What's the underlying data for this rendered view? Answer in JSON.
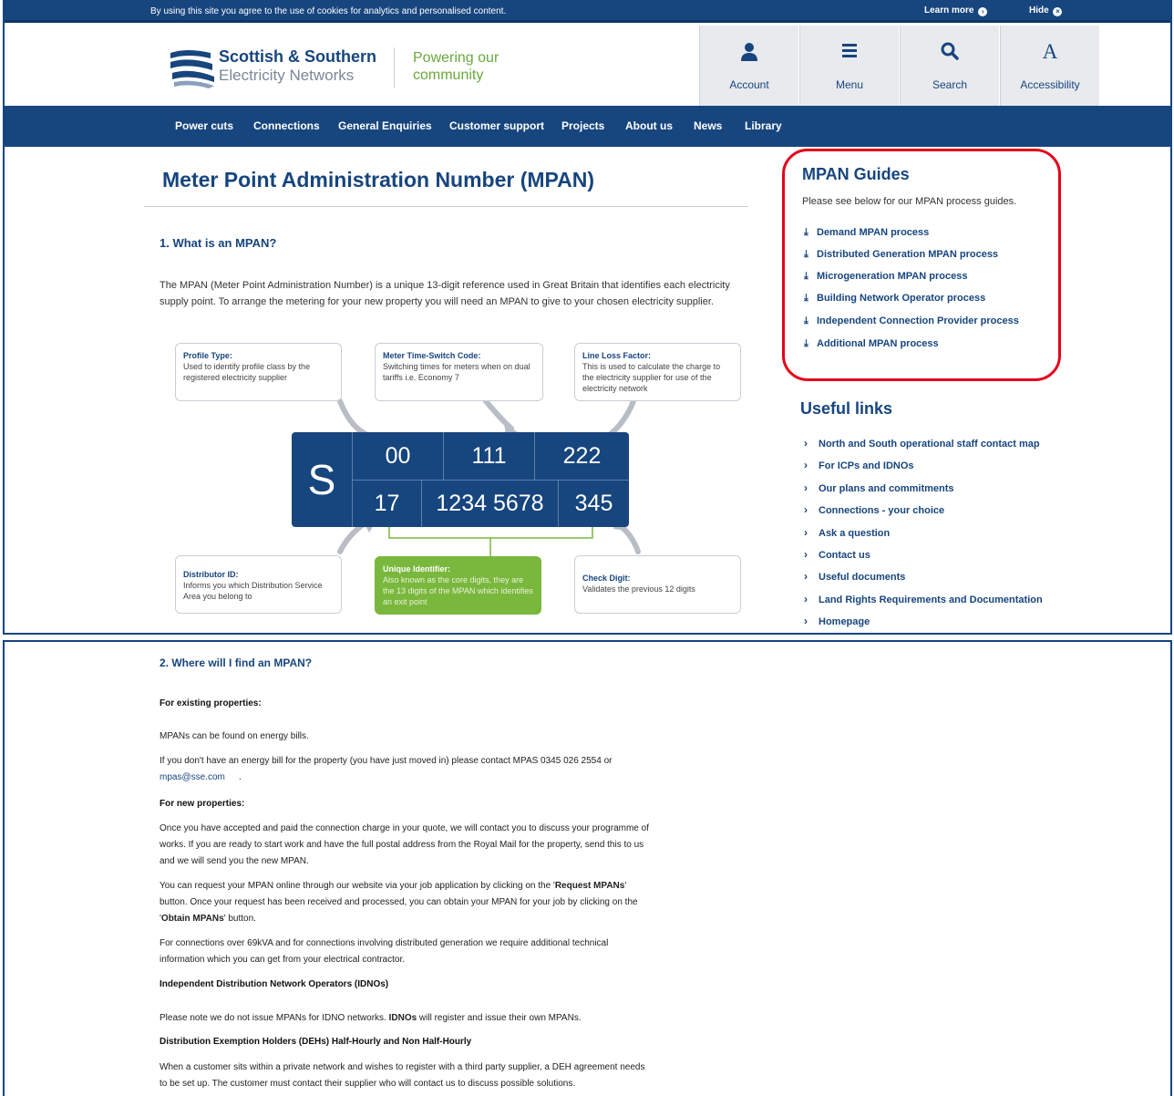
{
  "cookie": {
    "message": "By using this site you agree to the use of cookies for analytics and personalised content.",
    "learn_more": "Learn more",
    "hide": "Hide"
  },
  "brand": {
    "line1": "Scottish & Southern",
    "line2": "Electricity Networks",
    "tagline1": "Powering our",
    "tagline2": "community"
  },
  "header_buttons": [
    {
      "label": "Account",
      "icon": "account-icon"
    },
    {
      "label": "Menu",
      "icon": "menu-icon"
    },
    {
      "label": "Search",
      "icon": "search-icon"
    },
    {
      "label": "Accessibility",
      "icon": "accessibility-icon"
    }
  ],
  "nav": [
    "Power cuts",
    "Connections",
    "General Enquiries",
    "Customer support",
    "Projects",
    "About us",
    "News",
    "Library"
  ],
  "page_title": "Meter Point Administration Number (MPAN)",
  "section1": {
    "heading": "1. What is an MPAN?",
    "intro": "The MPAN (Meter Point Administration Number) is a unique 13-digit reference used in Great Britain that identifies each electricity supply point. To arrange the metering for your new property you will need an MPAN to give to your chosen electricity supplier."
  },
  "diagram": {
    "s": "S",
    "top_cells": [
      "00",
      "111",
      "222"
    ],
    "bottom_cells": [
      "17",
      "1234 5678",
      "345"
    ],
    "cards": {
      "profile": {
        "title": "Profile Type:",
        "text": "Used to identify profile class by the registered electricity supplier"
      },
      "mtc": {
        "title": "Meter Time-Switch Code:",
        "text": "Switching times for meters when on dual tariffs i.e. Economy 7"
      },
      "llf": {
        "title": "Line Loss Factor:",
        "text": "This is used to calculate the charge to the electricity supplier for use of the electricity network"
      },
      "distributor": {
        "title": "Distributor ID:",
        "text": "Informs you which Distribution Service Area you belong to"
      },
      "unique": {
        "title": "Unique Identifier:",
        "text": "Also known as the core digits, they are the 13 digits of the MPAN which identifies an exit point"
      },
      "check": {
        "title": "Check Digit:",
        "text": "Validates the previous 12 digits"
      }
    }
  },
  "mpan_guides": {
    "heading": "MPAN Guides",
    "intro": "Please see below for our MPAN process guides.",
    "links": [
      "Demand MPAN process",
      "Distributed Generation MPAN process",
      "Microgeneration MPAN process",
      "Building Network Operator process",
      "Independent Connection Provider process",
      "Additional MPAN process"
    ]
  },
  "useful_links": {
    "heading": "Useful links",
    "links": [
      "North and South operational staff contact map",
      "For ICPs and IDNOs",
      "Our plans and commitments",
      "Connections - your choice",
      "Ask a question",
      "Contact us",
      "Useful documents",
      "Land Rights Requirements and Documentation",
      "Homepage"
    ]
  },
  "section2": {
    "heading": "2. Where will I find an MPAN?",
    "existing_heading": "For existing properties:",
    "existing_p1": "MPANs can be found on energy bills.",
    "existing_p2": "If you don't have an energy bill for the property (you have just moved in) please contact MPAS 0345 026 2554 or",
    "email": "mpas@sse.com",
    "new_heading": "For new properties:",
    "new_p1_l1": "Once you have accepted and paid the connection charge in your quote, we will contact you to discuss your programme of",
    "new_p1_l2": "works. If you are ready to start work and have the full postal address from the Royal Mail for the property, send this to us",
    "new_p1_l3": "and we will send you the new MPAN.",
    "new_p2_a": "You can request your MPAN online through our website via your job application by clicking on the '",
    "new_p2_b": "Request MPANs",
    "new_p2_c": "'",
    "new_p2_l2": "button.  Once your request has been received and processed, you can obtain your MPAN for your job by clicking on the",
    "new_p2_l3a": "'",
    "new_p2_l3b": "Obtain MPANs",
    "new_p2_l3c": "' button.",
    "new_p3_l1": "For connections over 69kVA and for connections involving distributed generation we require additional technical",
    "new_p3_l2": "information which you can get from your electrical contractor.",
    "idno_heading": "Independent Distribution Network Operators (IDNOs)",
    "idno_p_a": "Please note we do not issue MPANs for IDNO networks. ",
    "idno_p_b": "IDNOs",
    "idno_p_c": " will register and issue their own MPANs.",
    "deh_heading": "Distribution Exemption Holders (DEHs) Half-Hourly and Non Half-Hourly",
    "deh_p_l1": "When a customer sits within a private network and wishes to register with a third party supplier, a DEH agreement needs",
    "deh_p_l2": "to be set up. The customer must contact their supplier who will contact us to discuss possible solutions."
  }
}
